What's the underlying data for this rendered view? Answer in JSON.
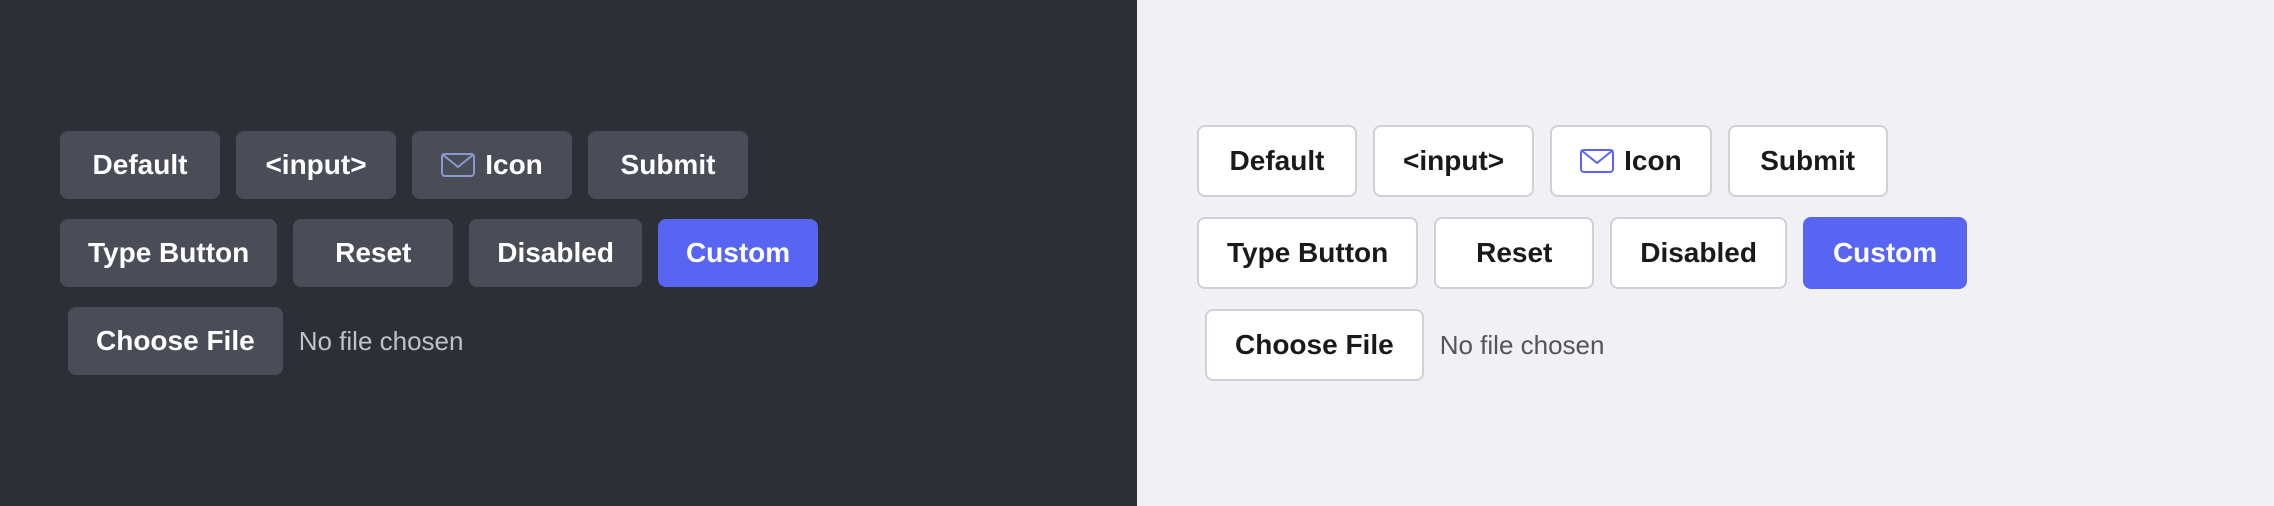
{
  "dark_panel": {
    "bg": "#2d2f36",
    "row1": {
      "buttons": [
        {
          "id": "default",
          "label": "Default",
          "type": "default"
        },
        {
          "id": "input",
          "label": "<input>",
          "type": "default"
        },
        {
          "id": "icon",
          "label": "Icon",
          "type": "icon"
        },
        {
          "id": "submit",
          "label": "Submit",
          "type": "default"
        }
      ]
    },
    "row2": {
      "buttons": [
        {
          "id": "type-button",
          "label": "Type Button",
          "type": "default"
        },
        {
          "id": "reset",
          "label": "Reset",
          "type": "default"
        },
        {
          "id": "disabled",
          "label": "Disabled",
          "type": "default"
        },
        {
          "id": "custom",
          "label": "Custom",
          "type": "custom"
        }
      ]
    },
    "file": {
      "button_label": "Choose File",
      "status": "No file chosen"
    }
  },
  "light_panel": {
    "bg": "#f0f0f5",
    "row1": {
      "buttons": [
        {
          "id": "default",
          "label": "Default",
          "type": "default"
        },
        {
          "id": "input",
          "label": "<input>",
          "type": "default"
        },
        {
          "id": "icon",
          "label": "Icon",
          "type": "icon"
        },
        {
          "id": "submit",
          "label": "Submit",
          "type": "default"
        }
      ]
    },
    "row2": {
      "buttons": [
        {
          "id": "type-button",
          "label": "Type Button",
          "type": "default"
        },
        {
          "id": "reset",
          "label": "Reset",
          "type": "default"
        },
        {
          "id": "disabled",
          "label": "Disabled",
          "type": "default"
        },
        {
          "id": "custom",
          "label": "Custom",
          "type": "custom"
        }
      ]
    },
    "file": {
      "button_label": "Choose File",
      "status": "No file chosen"
    }
  },
  "icons": {
    "email": "✉"
  }
}
